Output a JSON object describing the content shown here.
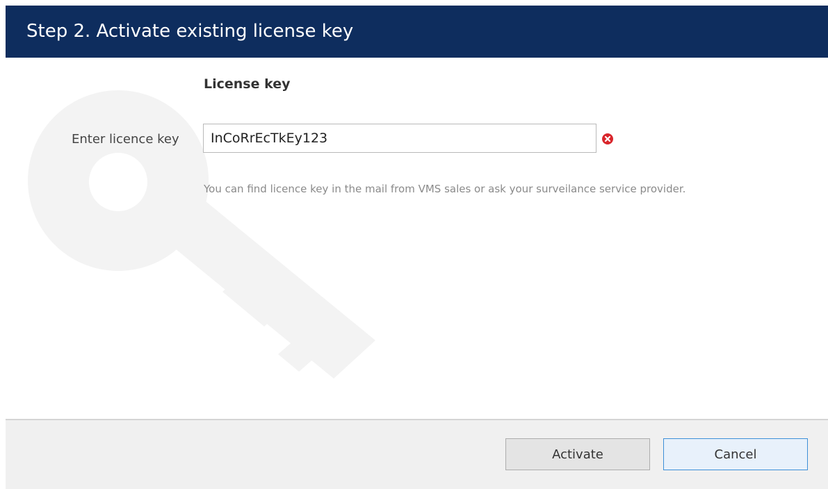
{
  "title": "Step 2. Activate existing license key",
  "section_heading": "License key",
  "field": {
    "label": "Enter licence key",
    "value": "InCoRrEcTkEy123"
  },
  "hint": "You can find licence key in the mail from VMS sales or ask your surveilance service provider.",
  "buttons": {
    "activate_label": "Activate",
    "cancel_label": "Cancel"
  },
  "colors": {
    "title_bar": "#0e2d5e",
    "error_icon": "#d9262c",
    "cancel_border": "#3c8fd8",
    "watermark": "#f3f3f3"
  },
  "icons": {
    "watermark": "key-icon",
    "error": "error-icon"
  }
}
